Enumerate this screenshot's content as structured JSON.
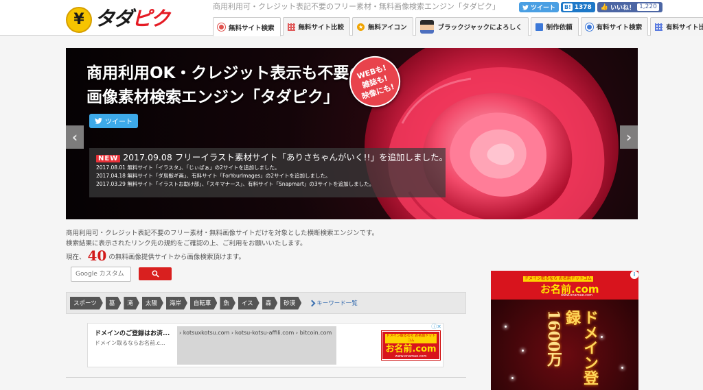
{
  "colors": {
    "brand_red": "#e51b24",
    "brand_yellow": "#f6c400",
    "search_red": "#d9201f",
    "twitter": "#4a9fe3",
    "hatena": "#1d78c8",
    "facebook": "#4c66a4"
  },
  "logo": {
    "glyph": "¥",
    "left": "タダ",
    "right": "ピク"
  },
  "tagline": "商用利用可・クレジット表記不要のフリー素材・無料画像検索エンジン「タダピク」",
  "social": {
    "tweet": "ツイート",
    "hatena_label": "B!",
    "hatena_count": "1378",
    "like": "いいね！",
    "like_count": "1,220"
  },
  "nav": [
    {
      "label": "無料サイト検索",
      "icon": "search-pin-icon",
      "active": true
    },
    {
      "label": "無料サイト比較",
      "icon": "grid-icon"
    },
    {
      "label": "無料アイコン",
      "icon": "star-icon"
    },
    {
      "label": "ブラックジャックによろしく",
      "icon": "face-icon"
    },
    {
      "label": "制作依頼",
      "icon": "monitor-icon"
    },
    {
      "label": "有料サイト検索",
      "icon": "search-pin-icon"
    },
    {
      "label": "有料サイト比較",
      "icon": "grid-icon"
    }
  ],
  "hero": {
    "title_line1": "商用利用OK・クレジット表示も不要の",
    "title_line2": "画像素材検索エンジン「タダピク」",
    "badge": [
      "WEBも!",
      "雑誌も!",
      "映像にも!"
    ],
    "tweet": "ツイート",
    "prev": "‹",
    "next": "›"
  },
  "news": {
    "badge": "NEW",
    "headline": "2017.09.08 フリーイラスト素材サイト「ありさちゃんがいく!!」を追加しました。",
    "items": [
      "2017.08.01 無料サイト「イラスタ」、「じぃばぁ」の2サイトを追加しました。",
      "2017.04.18 無料サイト「ダ鳥獣ギ画」、有料サイト「ForYourImages」の2サイトを追加しました。",
      "2017.03.29 無料サイト「イラストお助け部」、「スキマナース」、有料サイト「Snapmart」の3サイトを追加しました。"
    ]
  },
  "description": {
    "line1": "商用利用可・クレジット表記不要のフリー素材・無料画像サイトだけを対象とした横断検索エンジンです。",
    "line2": "検索結果に表示されたリンク先の規約をご確認の上、ご利用をお願いいたします。"
  },
  "count": {
    "prefix": "現在、",
    "number": "40",
    "suffix": "の無料画像提供サイトから画像検索頂けます。"
  },
  "search": {
    "placeholder": "Google カスタム"
  },
  "keywords": [
    "スポーツ",
    "墓",
    "滝",
    "太陽",
    "海岸",
    "自転車",
    "魚",
    "イス",
    "森",
    "砂漠"
  ],
  "keyword_link": "キーワード一覧",
  "ad1": {
    "title": "ドメインのご登録はお済...",
    "sub": "ドメイン取るならお名前.c...",
    "links": "› kotsuxkotsu.com › kotsu-kotsu-affili.com › bitcoin.com",
    "banner_small": "ドメイン取るなら お名前ドットコム",
    "banner_big": "お名前.com",
    "banner_url": "www.onamae.com",
    "marker": "ⓘ✕"
  },
  "ad2": {
    "small": "ドメイン取るなら お名前ドットコム",
    "big": "お名前.com",
    "url": "www.onamae.com",
    "v1": "ドメイン登録",
    "v2": "1600万",
    "marker": "i"
  }
}
